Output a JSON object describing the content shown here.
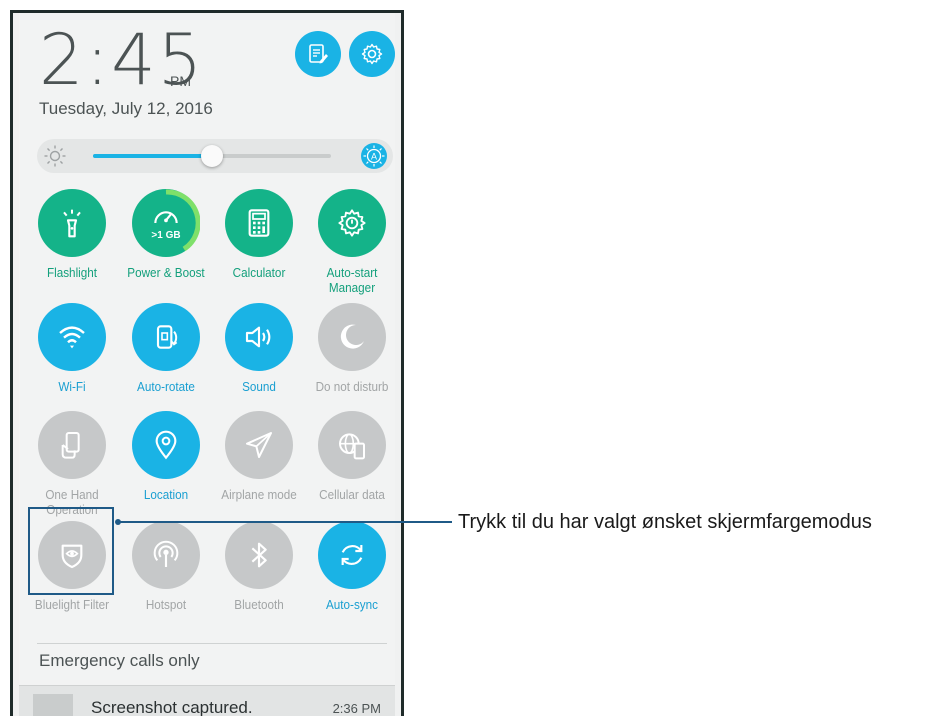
{
  "clock": {
    "time": "2:45",
    "ampm": "PM",
    "date": "Tuesday, July 12, 2016"
  },
  "header_buttons": [
    {
      "icon": "notes-edit-icon"
    },
    {
      "icon": "gear-icon"
    }
  ],
  "brightness": {
    "level": 0.5,
    "auto_label": "A"
  },
  "tiles": [
    {
      "label": "Flashlight",
      "state": "on",
      "color": "#14b389",
      "icon": "flashlight-icon"
    },
    {
      "label": "Power & Boost",
      "state": "on",
      "color": "#14b389",
      "icon": "speedometer-icon",
      "badge": ">1 GB"
    },
    {
      "label": "Calculator",
      "state": "on",
      "color": "#14b389",
      "icon": "calculator-icon"
    },
    {
      "label": "Auto-start\nManager",
      "state": "on",
      "color": "#14b389",
      "icon": "gear-power-icon"
    },
    {
      "label": "Wi-Fi",
      "state": "on",
      "color": "#1ab3e5",
      "icon": "wifi-icon"
    },
    {
      "label": "Auto-rotate",
      "state": "on",
      "color": "#1ab3e5",
      "icon": "rotate-icon"
    },
    {
      "label": "Sound",
      "state": "on",
      "color": "#1ab3e5",
      "icon": "speaker-icon"
    },
    {
      "label": "Do not disturb",
      "state": "off",
      "color": "#c6c8c9",
      "icon": "moon-icon"
    },
    {
      "label": "One Hand\nOperation",
      "state": "off",
      "color": "#c6c8c9",
      "icon": "one-hand-icon"
    },
    {
      "label": "Location",
      "state": "on",
      "color": "#1ab3e5",
      "icon": "location-pin-icon"
    },
    {
      "label": "Airplane mode",
      "state": "off",
      "color": "#c6c8c9",
      "icon": "airplane-icon"
    },
    {
      "label": "Cellular data",
      "state": "off",
      "color": "#c6c8c9",
      "icon": "globe-phone-icon"
    },
    {
      "label": "Bluelight Filter",
      "state": "off",
      "color": "#c6c8c9",
      "icon": "eye-shield-icon"
    },
    {
      "label": "Hotspot",
      "state": "off",
      "color": "#c6c8c9",
      "icon": "hotspot-icon"
    },
    {
      "label": "Bluetooth",
      "state": "off",
      "color": "#c6c8c9",
      "icon": "bluetooth-icon"
    },
    {
      "label": "Auto-sync",
      "state": "on",
      "color": "#1ab3e5",
      "icon": "sync-icon"
    }
  ],
  "status": {
    "emergency": "Emergency calls only"
  },
  "notification": {
    "title": "Screenshot captured.",
    "time": "2:36 PM"
  },
  "callout": {
    "text": "Trykk til du har valgt ønsket skjermfargemodus"
  }
}
